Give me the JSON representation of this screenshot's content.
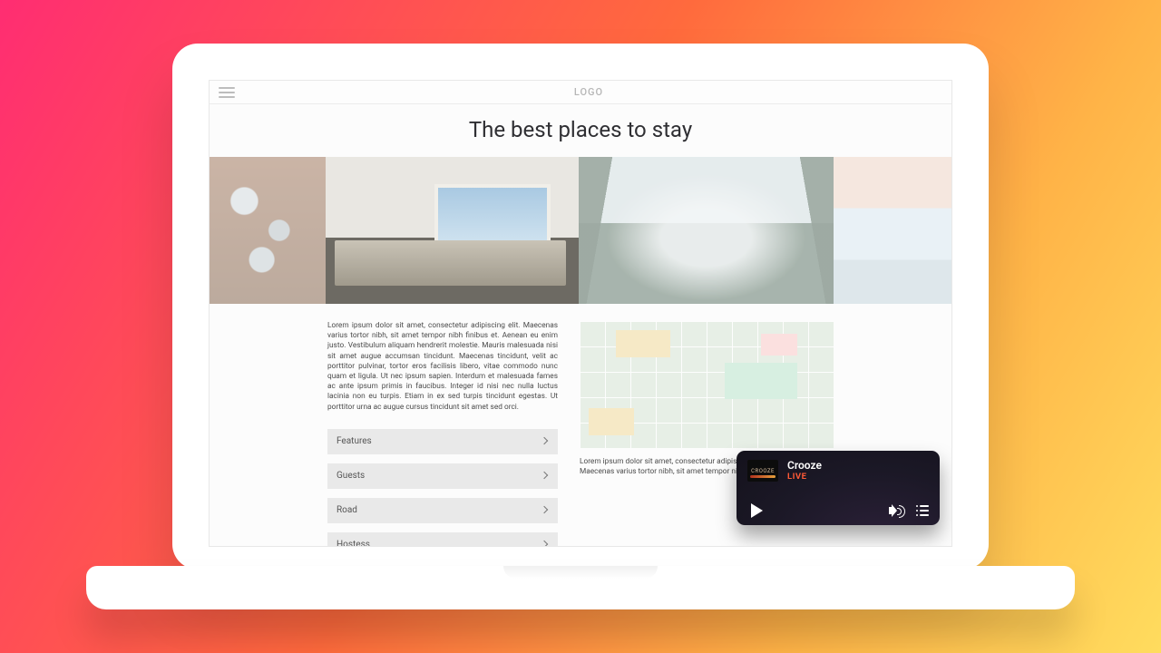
{
  "header": {
    "logo": "LOGO"
  },
  "page": {
    "title": "The best places to stay",
    "body_text": "Lorem ipsum dolor sit amet, consectetur adipiscing elit. Maecenas varius tortor nibh, sit amet tempor nibh finibus et. Aenean eu enim justo. Vestibulum aliquam hendrerit molestie. Mauris malesuada nisi sit amet augue accumsan tincidunt. Maecenas tincidunt, velit ac porttitor pulvinar, tortor eros facilisis libero, vitae commodo nunc quam et ligula. Ut nec ipsum sapien. Interdum et malesuada fames ac ante ipsum primis in faucibus. Integer id nisi nec nulla luctus lacinia non eu turpis. Etiam in ex sed turpis tincidunt egestas. Ut porttitor urna ac augue cursus tincidunt sit amet sed orci.",
    "map_caption": "Lorem ipsum dolor sit amet, consectetur adipiscing elit. Maecenas varius tortor nibh, sit amet tempor nibh finibus et"
  },
  "accordion": [
    {
      "label": "Features"
    },
    {
      "label": "Guests"
    },
    {
      "label": "Road"
    },
    {
      "label": "Hostess"
    }
  ],
  "player": {
    "brand": "CROOZE",
    "station": "Crooze",
    "status": "LIVE"
  }
}
